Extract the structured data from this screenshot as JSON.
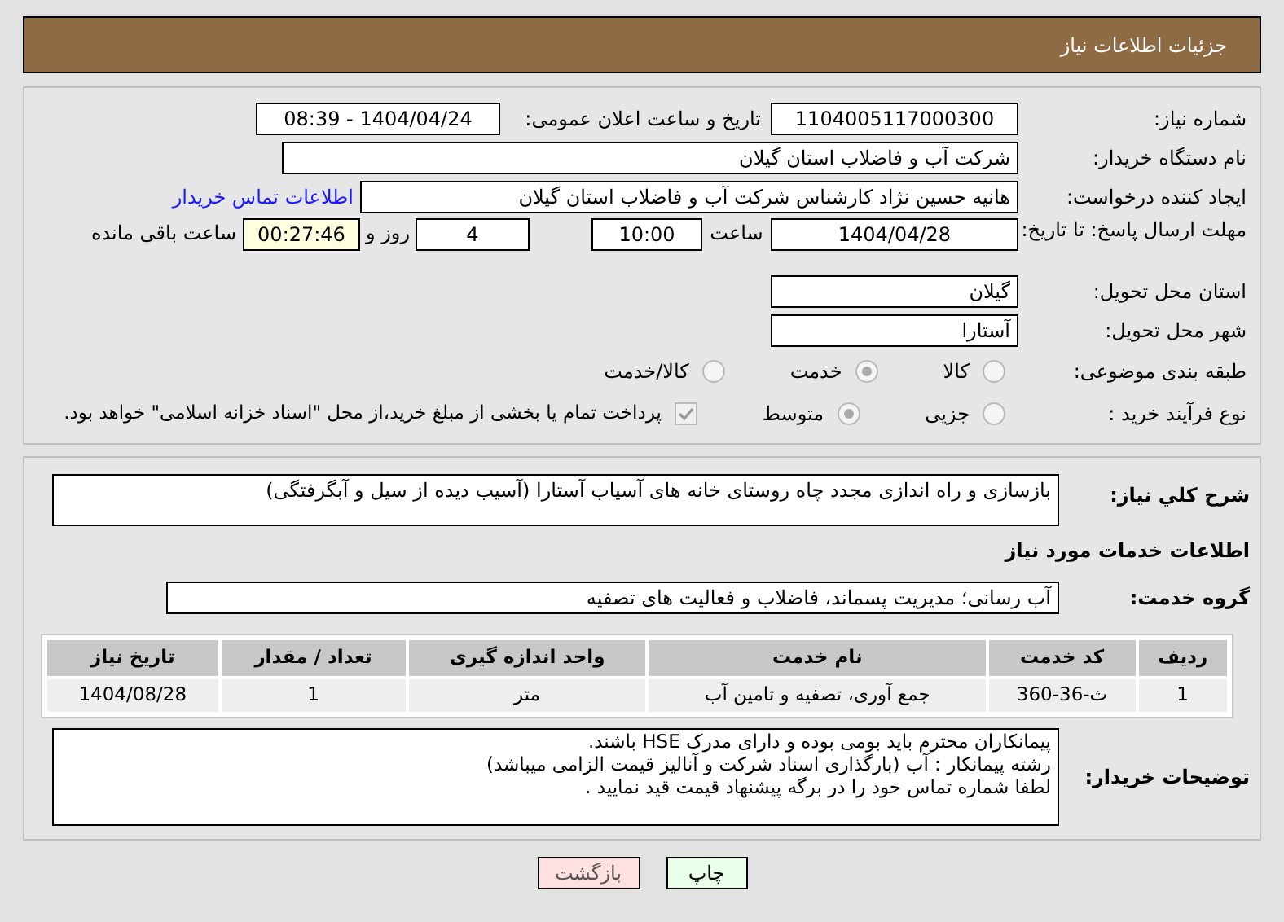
{
  "header": {
    "title": "جزئیات اطلاعات نیاز"
  },
  "details": {
    "need_number_label": "شماره نیاز:",
    "need_number": "1104005117000300",
    "announce_label": "تاریخ و ساعت اعلان عمومی:",
    "announce": "1404/04/24 - 08:39",
    "buyer_label": "نام دستگاه خریدار:",
    "buyer": "شرکت آب و فاضلاب استان گیلان",
    "requester_label": "ایجاد کننده درخواست:",
    "requester": "هانیه حسین نژاد کارشناس شرکت آب و فاضلاب استان گیلان",
    "contact_link": "اطلاعات تماس خریدار",
    "deadline_label": "مهلت ارسال پاسخ: تا تاریخ:",
    "deadline_date": "1404/04/28",
    "time_label": "ساعت",
    "time": "10:00",
    "days": "4",
    "days_label": "روز و",
    "remaining": "00:27:46",
    "remaining_label": "ساعت باقی مانده",
    "province_label": "استان محل تحویل:",
    "province": "گیلان",
    "city_label": "شهر محل تحویل:",
    "city": "آستارا",
    "category_label": "طبقه بندی موضوعی:",
    "category_options": [
      {
        "label": "کالا",
        "selected": false
      },
      {
        "label": "خدمت",
        "selected": true
      },
      {
        "label": "کالا/خدمت",
        "selected": false
      }
    ],
    "purchase_label": "نوع فرآیند خرید :",
    "purchase_options": [
      {
        "label": "جزیی",
        "selected": false
      },
      {
        "label": "متوسط",
        "selected": true
      }
    ],
    "payment_note": {
      "label": "پرداخت تمام یا بخشی از مبلغ خرید،از محل \"اسناد خزانه اسلامی\" خواهد بود.",
      "checked": true
    }
  },
  "summary": {
    "label": "شرح کلي نياز:",
    "value": "بازسازی و راه اندازی مجدد چاه روستای خانه های آسیاب آستارا (آسیب دیده از سیل و آبگرفتگی)"
  },
  "services_title": "اطلاعات خدمات مورد نیاز",
  "service_group": {
    "label": "گروه خدمت:",
    "value": "آب رسانی؛ مدیریت پسماند، فاضلاب و فعالیت های تصفیه"
  },
  "table": {
    "columns": [
      "ردیف",
      "کد خدمت",
      "نام خدمت",
      "واحد اندازه گیری",
      "تعداد / مقدار",
      "تاریخ نیاز"
    ],
    "rows": [
      [
        "1",
        "ث-36-360",
        "جمع آوری، تصفیه و تامین آب",
        "متر",
        "1",
        "1404/08/28"
      ]
    ]
  },
  "buyer_notes": {
    "label": "توضیحات خریدار:",
    "lines": [
      "پیمانکاران محترم باید بومی بوده و  دارای مدرک HSE باشند.",
      "رشته پیمانکار :   آب (بارگذاری اسناد شرکت و آنالیز قیمت الزامی میباشد)",
      "لطفا شماره تماس خود را در برگه پیشنهاد قیمت قید نمایید ."
    ]
  },
  "buttons": [
    {
      "label": "چاپ",
      "kind": "print"
    },
    {
      "label": "بازگشت",
      "kind": "back"
    }
  ]
}
